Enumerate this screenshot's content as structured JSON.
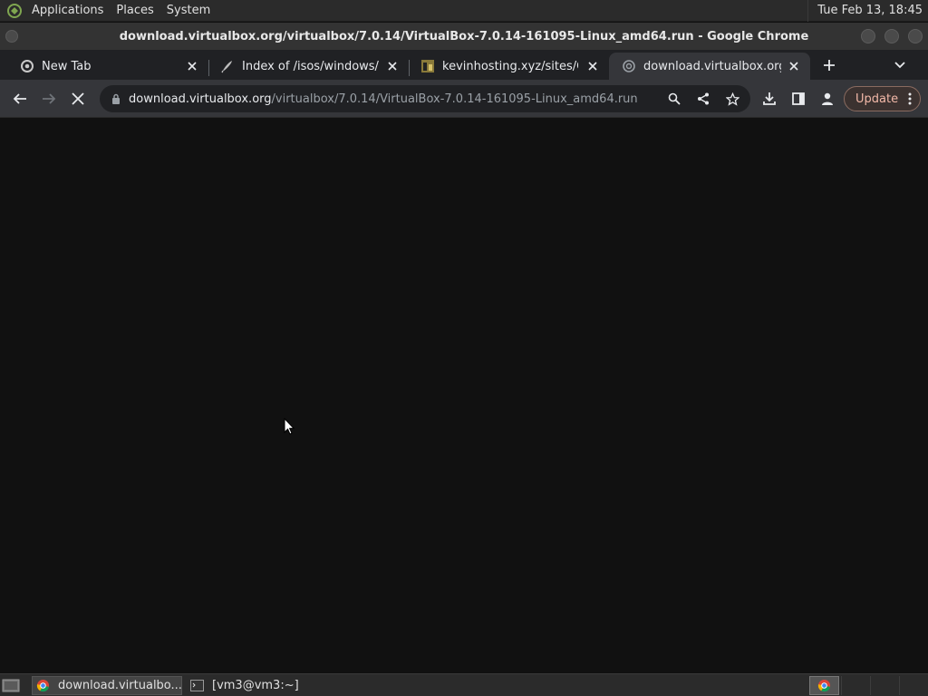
{
  "top_panel": {
    "menus": [
      "Applications",
      "Places",
      "System"
    ],
    "clock": "Tue Feb 13, 18:45"
  },
  "window": {
    "title": "download.virtualbox.org/virtualbox/7.0.14/VirtualBox-7.0.14-161095-Linux_amd64.run - Google Chrome"
  },
  "tabs": [
    {
      "label": "New Tab",
      "icon": "chrome-icon",
      "active": false
    },
    {
      "label": "Index of /isos/windows/",
      "icon": "apache-feather-icon",
      "active": false
    },
    {
      "label": "kevinhosting.xyz/sites/Coll",
      "icon": "site-favicon",
      "active": false
    },
    {
      "label": "download.virtualbox.org/vi",
      "icon": "loading-globe-icon",
      "active": true
    }
  ],
  "omnibox": {
    "url_host": "download.virtualbox.org",
    "url_path": "/virtualbox/7.0.14/VirtualBox-7.0.14-161095-Linux_amd64.run"
  },
  "toolbar": {
    "update_label": "Update"
  },
  "taskbar": {
    "items": [
      {
        "label": "download.virtualbo...",
        "icon": "chrome-icon",
        "active": true
      },
      {
        "label": "[vm3@vm3:~]",
        "icon": "terminal-icon",
        "active": false
      }
    ]
  },
  "colors": {
    "tab_strip": "#202124",
    "toolbar": "#35363a",
    "content_bg": "#111111",
    "update_accent": "#f2b8a8"
  }
}
